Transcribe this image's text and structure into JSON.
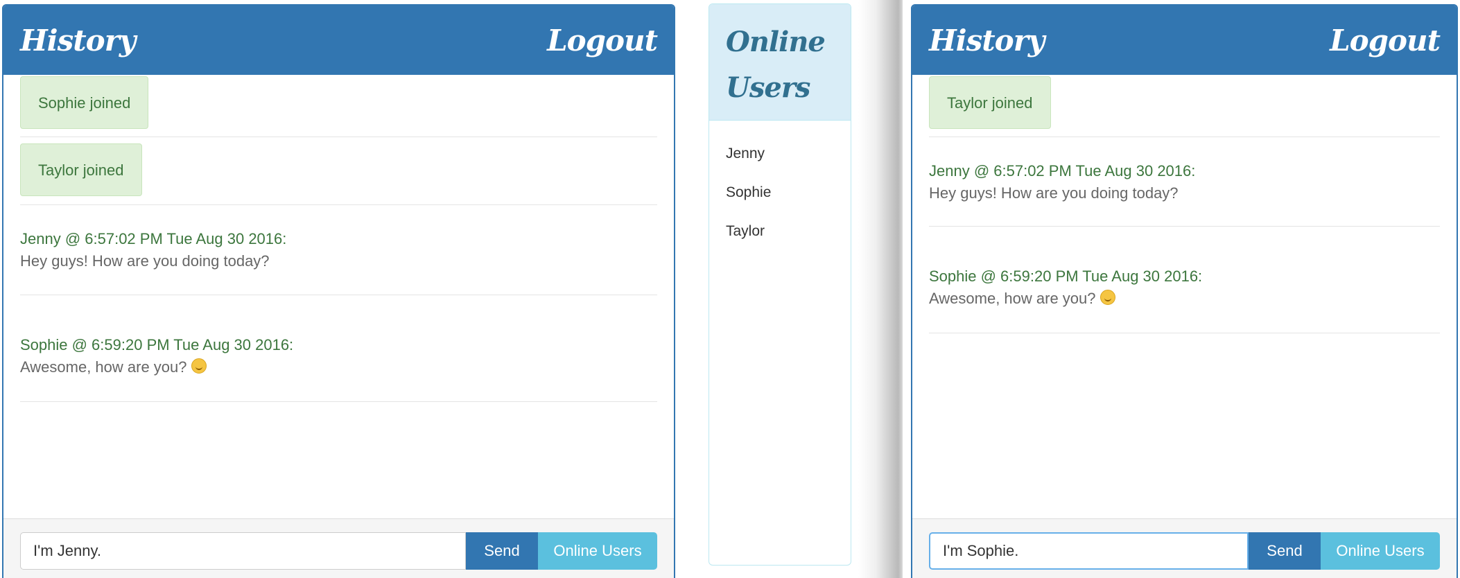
{
  "left_chat": {
    "title": "History",
    "logout_label": "Logout",
    "joins": [
      "Sophie joined",
      "Taylor joined"
    ],
    "messages": [
      {
        "meta": "Jenny @ 6:57:02 PM Tue Aug 30 2016:",
        "text": "Hey guys! How are you doing today?"
      },
      {
        "meta": "Sophie @ 6:59:20 PM Tue Aug 30 2016:",
        "text": "Awesome, how are you?"
      }
    ],
    "input_value": "I'm Jenny.",
    "send_label": "Send",
    "online_button_label": "Online Users"
  },
  "online_users": {
    "title_line1": "Online",
    "title_line2": "Users",
    "users": [
      "Jenny",
      "Sophie",
      "Taylor"
    ]
  },
  "right_chat": {
    "title": "History",
    "logout_label": "Logout",
    "joins": [
      "Taylor joined"
    ],
    "messages": [
      {
        "meta": "Jenny @ 6:57:02 PM Tue Aug 30 2016:",
        "text": "Hey guys! How are you doing today?"
      },
      {
        "meta": "Sophie @ 6:59:20 PM Tue Aug 30 2016:",
        "text": "Awesome, how are you?"
      }
    ],
    "input_value": "I'm Sophie.",
    "send_label": "Send",
    "online_button_label": "Online Users"
  },
  "colors": {
    "primary": "#3276b1",
    "info": "#5bc0de",
    "success_bg": "#dff0d8",
    "success_text": "#3c763d",
    "info_bg": "#d9edf7",
    "info_text": "#31708f"
  },
  "icons": [
    "smiling-face-emoji-icon"
  ]
}
